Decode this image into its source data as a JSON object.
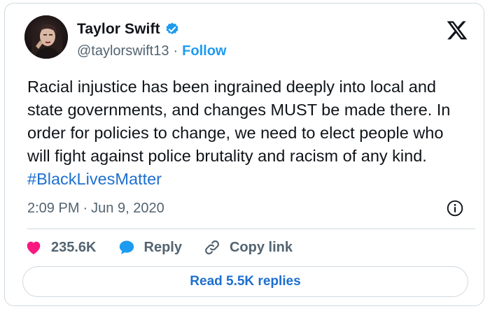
{
  "author": {
    "display_name": "Taylor Swift",
    "handle": "@taylorswift13",
    "separator": "·",
    "follow_label": "Follow",
    "verified": true
  },
  "tweet": {
    "text": "Racial injustice has been ingrained deeply into local and state governments, and changes MUST be made there. In order for policies to change, we need to elect people who will fight against police brutality and racism of any kind. ",
    "hashtag": "#BlackLivesMatter"
  },
  "meta": {
    "time": "2:09 PM",
    "separator": "·",
    "date": "Jun 9, 2020"
  },
  "actions": {
    "likes": "235.6K",
    "reply_label": "Reply",
    "copy_link_label": "Copy link"
  },
  "read_replies_label": "Read 5.5K replies",
  "icons": {
    "like": "heart-icon",
    "reply": "speech-bubble-icon",
    "copy_link": "link-icon",
    "info": "info-icon",
    "brand": "x-logo-icon",
    "verified": "verified-badge-icon"
  },
  "colors": {
    "accent": "#1d9bf0",
    "hashtag": "#1d6fd0",
    "like": "#f91880",
    "secondary_text": "#536471",
    "border": "#cfd9de"
  }
}
